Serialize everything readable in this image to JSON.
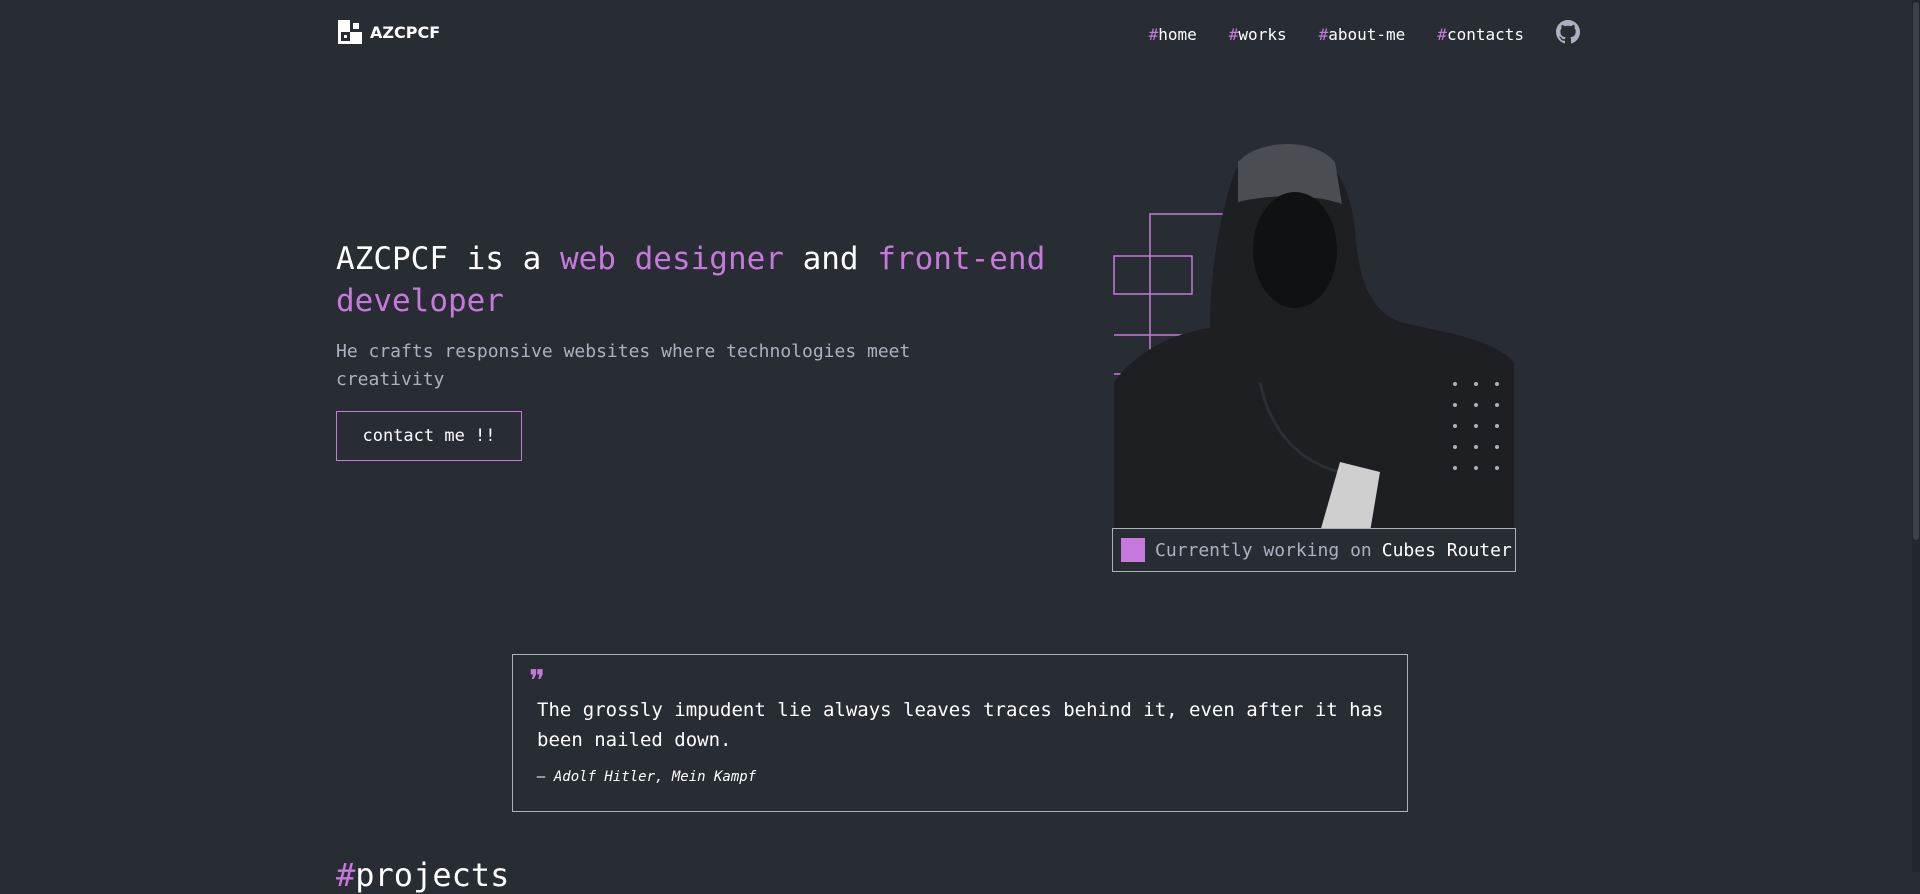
{
  "header": {
    "logo_text": "AZCPCF",
    "nav": [
      {
        "hash": "#",
        "label": "home"
      },
      {
        "hash": "#",
        "label": "works"
      },
      {
        "hash": "#",
        "label": "about-me"
      },
      {
        "hash": "#",
        "label": "contacts"
      }
    ],
    "github_icon": "github-icon"
  },
  "hero": {
    "title_part1": "AZCPCF is a ",
    "title_accent1": "web designer",
    "title_part2": " and ",
    "title_accent2": "front-end developer",
    "subtitle": "He crafts responsive websites where technologies meet creativity",
    "button_label": "contact me !!"
  },
  "status": {
    "prefix": "Currently working on",
    "project": "Cubes Router"
  },
  "quote": {
    "icon": "quote-icon",
    "text": "The grossly impudent lie always leaves traces behind it, even after it has been nailed down.",
    "author": "— Adolf Hitler, Mein Kampf"
  },
  "next_section": {
    "hash": "#",
    "title": "projects"
  },
  "colors": {
    "background": "#282c33",
    "accent": "#c778dd",
    "muted": "#abb2bf",
    "text": "#ffffff"
  }
}
